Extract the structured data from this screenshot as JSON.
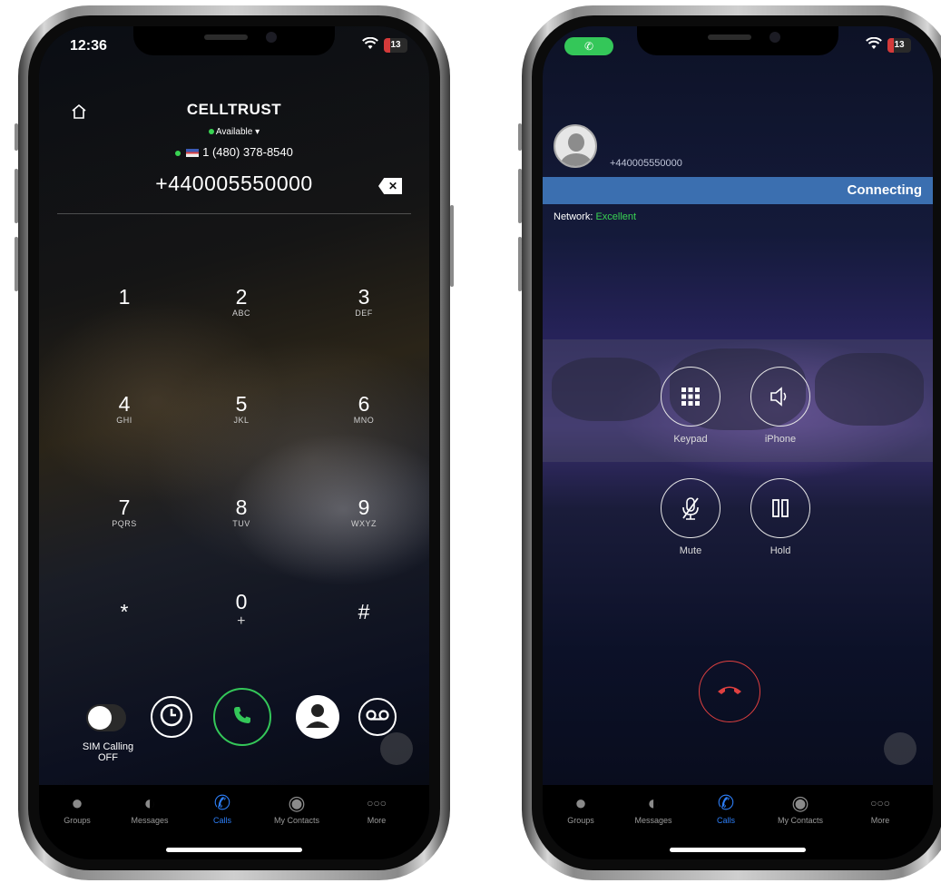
{
  "left_phone": {
    "status": {
      "time": "12:36",
      "battery": "13"
    },
    "header": {
      "logo": "CELLTRUST",
      "availability": "Available",
      "my_number": "1 (480) 378-8540"
    },
    "dial_number": "+440005550000",
    "keypad": [
      {
        "digit": "1",
        "letters": ""
      },
      {
        "digit": "2",
        "letters": "ABC"
      },
      {
        "digit": "3",
        "letters": "DEF"
      },
      {
        "digit": "4",
        "letters": "GHI"
      },
      {
        "digit": "5",
        "letters": "JKL"
      },
      {
        "digit": "6",
        "letters": "MNO"
      },
      {
        "digit": "7",
        "letters": "PQRS"
      },
      {
        "digit": "8",
        "letters": "TUV"
      },
      {
        "digit": "9",
        "letters": "WXYZ"
      },
      {
        "digit": "*",
        "letters": ""
      },
      {
        "digit": "0",
        "letters": "+"
      },
      {
        "digit": "#",
        "letters": ""
      }
    ],
    "sim_calling": {
      "label": "SIM Calling",
      "state": "OFF"
    },
    "action_icons": [
      "clock-icon",
      "phone-icon",
      "contact-icon",
      "voicemail-icon"
    ]
  },
  "right_phone": {
    "status": {
      "battery": "13"
    },
    "caller_number": "+440005550000",
    "connection_status": "Connecting",
    "network": {
      "label": "Network:",
      "value": "Excellent"
    },
    "controls": [
      {
        "label": "Keypad",
        "icon": "keypad-icon"
      },
      {
        "label": "iPhone",
        "icon": "speaker-icon"
      },
      {
        "label": "Mute",
        "icon": "mic-off-icon"
      },
      {
        "label": "Hold",
        "icon": "pause-icon"
      }
    ]
  },
  "tabbar": {
    "items": [
      {
        "label": "Groups",
        "icon": "groups-icon"
      },
      {
        "label": "Messages",
        "icon": "messages-icon"
      },
      {
        "label": "Calls",
        "icon": "phone-icon",
        "active": true
      },
      {
        "label": "My Contacts",
        "icon": "contact-icon"
      },
      {
        "label": "More",
        "icon": "more-icon"
      }
    ]
  },
  "colors": {
    "accent_blue": "#2d7ff9",
    "green": "#34c759",
    "connecting_bar": "#3b6fb0",
    "hangup_red": "#e04040"
  }
}
